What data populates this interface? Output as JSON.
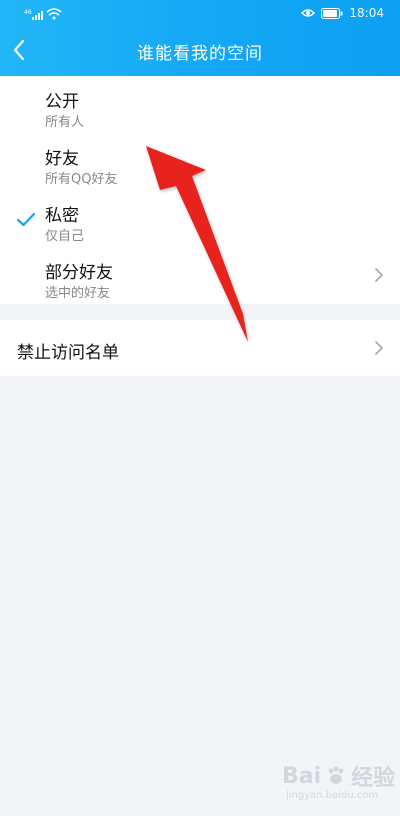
{
  "status_bar": {
    "signal_label": "⁴⁶ᵢₗₗ",
    "time": "18:04"
  },
  "header": {
    "title": "谁能看我的空间"
  },
  "options": [
    {
      "title": "公开",
      "subtitle": "所有人",
      "selected": false,
      "has_chevron": false
    },
    {
      "title": "好友",
      "subtitle": "所有QQ好友",
      "selected": false,
      "has_chevron": false
    },
    {
      "title": "私密",
      "subtitle": "仅自己",
      "selected": true,
      "has_chevron": false
    },
    {
      "title": "部分好友",
      "subtitle": "选中的好友",
      "selected": false,
      "has_chevron": true
    }
  ],
  "blacklist": {
    "label": "禁止访问名单"
  },
  "watermark": {
    "brand": "Bai",
    "brand_suffix": "经验",
    "sub": "jingyan.baidu.com"
  },
  "colors": {
    "header": "#12a6f5",
    "accent_check": "#18a4ee",
    "arrow": "#e8211f",
    "background": "#f3f4f8"
  }
}
